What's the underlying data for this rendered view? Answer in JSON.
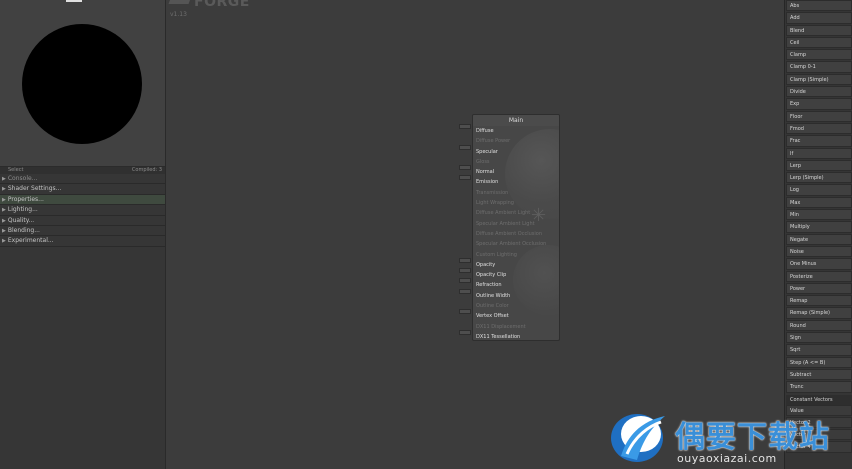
{
  "app": {
    "logo_text": "FORGE",
    "version": "v1.13"
  },
  "preview": {
    "footer_left": "Select",
    "footer_right": "Compiled: 3"
  },
  "sections": [
    {
      "label": "Console...",
      "state": "dim"
    },
    {
      "label": "Shader Settings...",
      "state": "normal"
    },
    {
      "label": "Properties...",
      "state": "active"
    },
    {
      "label": "Lighting...",
      "state": "normal"
    },
    {
      "label": "Quality...",
      "state": "normal"
    },
    {
      "label": "Blending...",
      "state": "normal"
    },
    {
      "label": "Experimental...",
      "state": "normal"
    }
  ],
  "main_node": {
    "title": "Main",
    "inputs": [
      {
        "label": "Diffuse",
        "enabled": true
      },
      {
        "label": "Diffuse Power",
        "enabled": false
      },
      {
        "label": "Specular",
        "enabled": true
      },
      {
        "label": "Gloss",
        "enabled": false
      },
      {
        "label": "Normal",
        "enabled": true
      },
      {
        "label": "Emission",
        "enabled": true
      },
      {
        "label": "Transmission",
        "enabled": false
      },
      {
        "label": "Light Wrapping",
        "enabled": false
      },
      {
        "label": "Diffuse Ambient Light",
        "enabled": false
      },
      {
        "label": "Specular Ambient Light",
        "enabled": false
      },
      {
        "label": "Diffuse Ambient Occlusion",
        "enabled": false
      },
      {
        "label": "Specular Ambient Occlusion",
        "enabled": false
      },
      {
        "label": "Custom Lighting",
        "enabled": false
      },
      {
        "label": "Opacity",
        "enabled": true
      },
      {
        "label": "Opacity Clip",
        "enabled": true
      },
      {
        "label": "Refraction",
        "enabled": true
      },
      {
        "label": "Outline Width",
        "enabled": true
      },
      {
        "label": "Outline Color",
        "enabled": false
      },
      {
        "label": "Vertex Offset",
        "enabled": true
      },
      {
        "label": "DX11 Displacement",
        "enabled": false
      },
      {
        "label": "DX11 Tessellation",
        "enabled": true
      }
    ]
  },
  "node_list": [
    "Abs",
    "Add",
    "Blend",
    "Ceil",
    "Clamp",
    "Clamp 0-1",
    "Clamp (Simple)",
    "Divide",
    "Exp",
    "Floor",
    "Fmod",
    "Frac",
    "If",
    "Lerp",
    "Lerp (Simple)",
    "Log",
    "Max",
    "Min",
    "Multiply",
    "Negate",
    "Noise",
    "One Minus",
    "Posterize",
    "Power",
    "Remap",
    "Remap (Simple)",
    "Round",
    "Sign",
    "Sqrt",
    "Step (A <= B)",
    "Subtract",
    "Trunc"
  ],
  "constant_header": "Constant Vectors",
  "constant_list": [
    "Value",
    "Vector 2",
    "Vector 3",
    "Vector 4"
  ],
  "watermark": {
    "title": "偶要下载站",
    "url": "ouyaoxiazai.com",
    "accent_color": "#3a8fd8"
  }
}
